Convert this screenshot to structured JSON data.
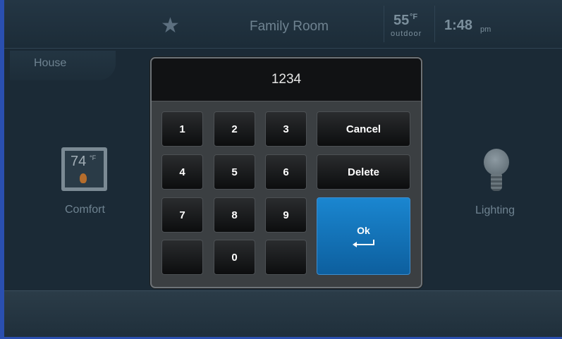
{
  "header": {
    "room": "Family Room",
    "weather": {
      "temperature": "55",
      "unit": "°F",
      "label": "outdoor"
    },
    "clock": {
      "time": "1:48",
      "ampm": "pm"
    }
  },
  "nav": {
    "house_tab": "House"
  },
  "tiles": {
    "comfort": {
      "label": "Comfort",
      "temp": "74",
      "unit": "°F"
    },
    "lighting": {
      "label": "Lighting"
    }
  },
  "keypad": {
    "display_value": "1234",
    "keys": {
      "k1": "1",
      "k2": "2",
      "k3": "3",
      "k4": "4",
      "k5": "5",
      "k6": "6",
      "k7": "7",
      "k8": "8",
      "k9": "9",
      "k0": "0"
    },
    "cancel_label": "Cancel",
    "delete_label": "Delete",
    "ok_label": "Ok"
  },
  "colors": {
    "background": "#1b2a36",
    "ok_button": "#1577bd",
    "frame_accent": "#2a4fb0"
  },
  "icons": [
    "star-icon",
    "thermostat-icon",
    "flame-icon",
    "light-bulb-icon",
    "enter-arrow-icon"
  ]
}
